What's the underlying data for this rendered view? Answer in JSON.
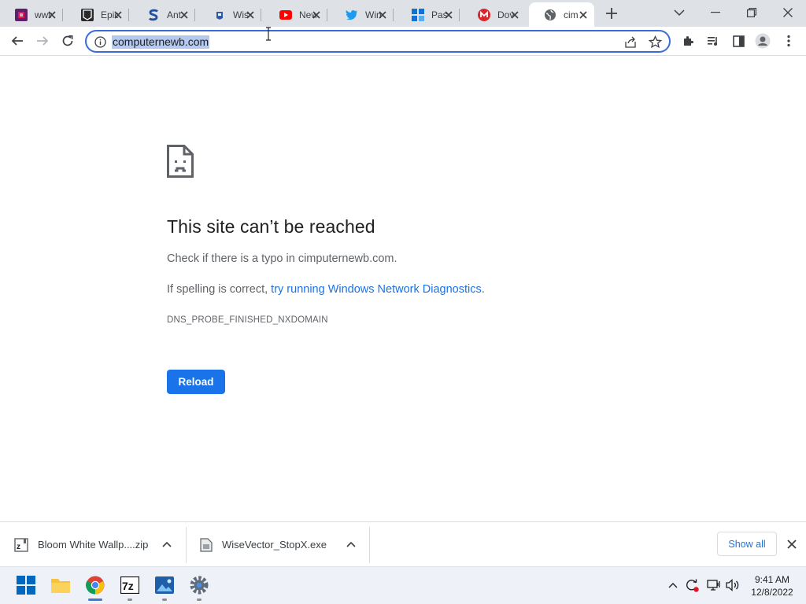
{
  "browser": {
    "tabs": [
      {
        "title": "www",
        "favicon": "slack-like-icon",
        "color": "#611f69"
      },
      {
        "title": "Epic",
        "favicon": "epic-games-icon",
        "color": "#2a2a2a"
      },
      {
        "title": "Ant",
        "favicon": "s-logo-icon",
        "color": "#1f4fa3"
      },
      {
        "title": "Wis",
        "favicon": "wise-icon",
        "color": "#2f5aa8"
      },
      {
        "title": "New",
        "favicon": "youtube-icon",
        "color": "#ff0000"
      },
      {
        "title": "Win",
        "favicon": "twitter-icon",
        "color": "#1d9bf0"
      },
      {
        "title": "Pas",
        "favicon": "windows-tiles-icon",
        "color": "#0a74da"
      },
      {
        "title": "Dov",
        "favicon": "mega-icon",
        "color": "#d9272e"
      },
      {
        "title": "cim",
        "favicon": "globe-icon",
        "color": "#5f6368"
      }
    ],
    "url": "computernewb.com"
  },
  "error_page": {
    "title": "This site can’t be reached",
    "line1": "Check if there is a typo in cimputernewb.com.",
    "line2_prefix": "If spelling is correct, ",
    "line2_link": "try running Windows Network Diagnostics",
    "line2_suffix": ".",
    "code": "DNS_PROBE_FINISHED_NXDOMAIN",
    "reload_label": "Reload"
  },
  "downloads": {
    "items": [
      {
        "name": "Bloom White Wallp....zip",
        "icon": "zip-archive-icon"
      },
      {
        "name": "WiseVector_StopX.exe",
        "icon": "exe-file-icon"
      }
    ],
    "show_all_label": "Show all"
  },
  "taskbar": {
    "apps": [
      "start-icon",
      "file-explorer-icon",
      "chrome-icon",
      "7zip-icon",
      "photos-icon",
      "settings-icon"
    ],
    "time": "9:41 AM",
    "date": "12/8/2022"
  },
  "colors": {
    "accent": "#1a73e8",
    "tabstrip": "#dee1e6",
    "omnibox_focus": "#3b6bd6"
  }
}
